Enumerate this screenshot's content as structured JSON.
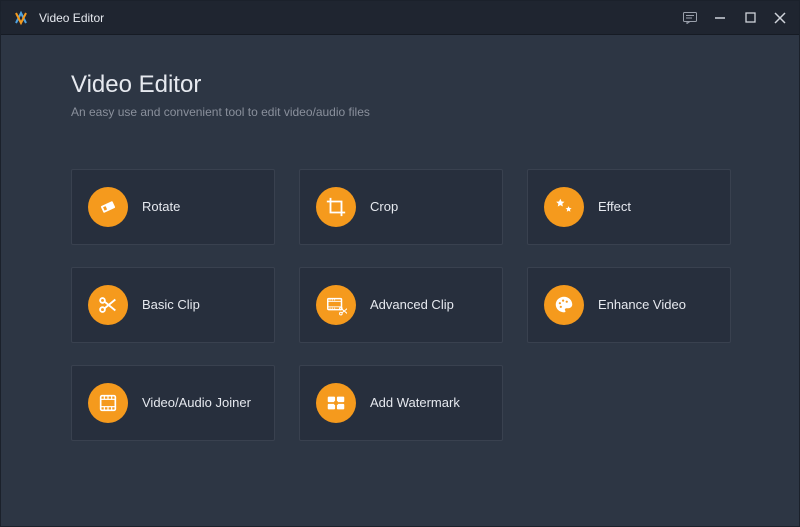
{
  "titlebar": {
    "title": "Video Editor"
  },
  "header": {
    "title": "Video Editor",
    "subtitle": "An easy use and convenient tool to edit video/audio files"
  },
  "tiles": [
    {
      "label": "Rotate"
    },
    {
      "label": "Crop"
    },
    {
      "label": "Effect"
    },
    {
      "label": "Basic Clip"
    },
    {
      "label": "Advanced Clip"
    },
    {
      "label": "Enhance Video"
    },
    {
      "label": "Video/Audio Joiner"
    },
    {
      "label": "Add Watermark"
    }
  ],
  "colors": {
    "accent": "#f59a1d",
    "bg": "#2d3644",
    "tile": "#272f3d",
    "titlebar": "#1f2530"
  }
}
